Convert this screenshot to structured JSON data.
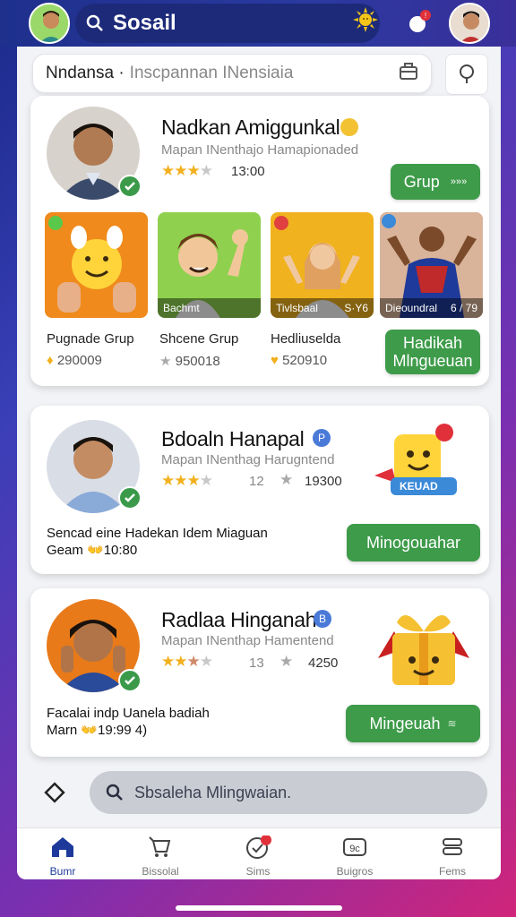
{
  "header": {
    "app_title": "Sosail",
    "icons": [
      "search-icon",
      "sun-icon",
      "chat-icon"
    ],
    "notification_count": ""
  },
  "breadcrumb": {
    "primary": "Nndansa ·",
    "secondary": "Inscpannan INensiaia"
  },
  "cards": [
    {
      "name": "Nadkan Amiggunkal",
      "subtitle": "Mapan INenthajo Hamapionaded",
      "rating": 3.5,
      "meta": "13:00",
      "button": "Grup",
      "button_arrow": "»»»",
      "tiles": [
        {
          "caption": "",
          "label": "Pugnade Grup",
          "count": "290009",
          "bg": "#f08a1c"
        },
        {
          "caption": "Bachmt",
          "label": "Shcene Grup",
          "count": "950018",
          "bg": "#8fd14e"
        },
        {
          "caption": "Tivlsbaal",
          "caption2": "S·Y6",
          "label": "Hedliuselda",
          "count": "520910",
          "bg": "#f0b21e"
        },
        {
          "caption": "Dieoundral",
          "caption2": "6 / 79",
          "label": "",
          "count": "",
          "bg": "#c83a2a"
        }
      ],
      "button2": "Hadikah Mlngueuan"
    },
    {
      "name": "Bdoaln Hanapal",
      "subtitle": "Mapan INenthag Harugntend",
      "rating": 3.5,
      "meta1": "12",
      "meta2": "19300",
      "sticker": "KEUAD",
      "desc_line1": "Sencad eine Hadekan Idem Miaguan",
      "desc_line2": "Geam 👐10:80",
      "button": "Minogouahar"
    },
    {
      "name": "Radlaa Hinganah",
      "subtitle": "Mapan INenthap Hamentend",
      "rating": 3.5,
      "meta1": "13",
      "meta2": "4250",
      "desc_line1": "Facalai indp Uanela badiah",
      "desc_line2": "Marn 👐19:99 4)",
      "button": "Mingeuah",
      "button_arrow": "≋"
    }
  ],
  "bottom_search": {
    "placeholder": "Sbsaleha Mlingwaian."
  },
  "nav": {
    "items": [
      {
        "label": "Bumr",
        "icon": "home-icon"
      },
      {
        "label": "Bissolal",
        "icon": "cart-icon"
      },
      {
        "label": "Sims",
        "icon": "check-circle-icon"
      },
      {
        "label": "Buigros",
        "icon": "badge-icon"
      },
      {
        "label": "Fems",
        "icon": "stack-icon"
      }
    ],
    "badge": ""
  },
  "colors": {
    "brand": "#2a3aa0",
    "accent_green": "#3e9b4a",
    "star": "#f2b01e"
  }
}
